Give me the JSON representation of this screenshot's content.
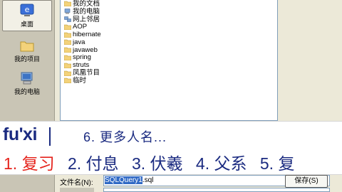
{
  "places": [
    {
      "label": "桌面",
      "icon": "desktop-icon"
    },
    {
      "label": "我的项目",
      "icon": "folder-icon"
    },
    {
      "label": "我的电脑",
      "icon": "computer-icon"
    }
  ],
  "files": [
    {
      "name": "我的文档",
      "icon": "documents-folder-icon"
    },
    {
      "name": "我的电脑",
      "icon": "computer-icon"
    },
    {
      "name": "网上邻居",
      "icon": "network-icon"
    },
    {
      "name": "AOP",
      "icon": "folder-icon"
    },
    {
      "name": "hibernate",
      "icon": "folder-icon"
    },
    {
      "name": "java",
      "icon": "folder-icon"
    },
    {
      "name": "javaweb",
      "icon": "folder-icon"
    },
    {
      "name": "spring",
      "icon": "folder-icon"
    },
    {
      "name": "struts",
      "icon": "folder-icon"
    },
    {
      "name": "凤凰节目",
      "icon": "folder-icon"
    },
    {
      "name": "临时",
      "icon": "folder-icon"
    }
  ],
  "ime": {
    "pinyin": "fu'xi",
    "more": "6. 更多人名...",
    "candidates": [
      "1. 复习",
      "2. 付息",
      "3. 伏羲",
      "4. 父系",
      "5. 复"
    ]
  },
  "filename": {
    "label": "文件名(N):",
    "value_highlight": "SQLQuery1",
    "value_rest": ".sql"
  },
  "save_button": "保存(S)",
  "colors": {
    "ime_text": "#1a2a80",
    "ime_selected": "#e5231c",
    "selection": "#316ac5"
  }
}
